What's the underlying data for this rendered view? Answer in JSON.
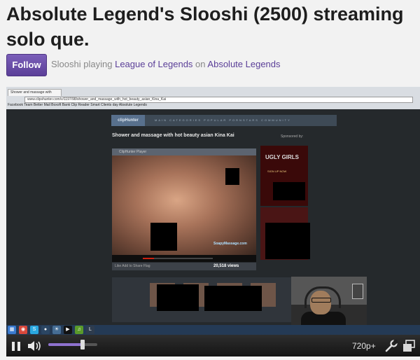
{
  "header": {
    "title": "Absolute Legend's Slooshi (2500) streaming solo que.",
    "follow_label": "Follow",
    "meta": {
      "user": "Slooshi",
      "playing": "playing",
      "game": "League of Legends",
      "on": "on",
      "team": "Absolute Legends"
    }
  },
  "stream": {
    "browser_tab": "Shower and massage with",
    "address": "www.clipshunter.com/v/1197/98/shower_and_massage_with_hot_beauty_asian_Kina_Kai",
    "bookmarks": "Facebook   Team Better   Mail   Boxoft   Bank   Clip Reader   Smart   Clients day   Absolute Legends",
    "site_logo": "clipHunter",
    "nav_items": "MAIN   CATEGORIES   POPULAR   PORNSTARS   COMMUNITY",
    "video_title": "Shower and massage with hot beauty asian Kina Kai",
    "sponsored_label": "Sponsored by:",
    "player_header": "ClipHunter Player",
    "watermark": "SoapyMassage.com",
    "views": "20,518 views",
    "toolbar_text": "Like   Add to   Share   Flag",
    "ad_text": "UGLY GIRLS",
    "ad_sub": "SIGN UP NOW",
    "taskbar_icons": [
      "win",
      "chrome",
      "skype",
      "steam",
      "media",
      "player",
      "spotify",
      "league"
    ]
  },
  "controls": {
    "volume_level": 0.7,
    "quality": "720p+"
  },
  "colors": {
    "brand_purple": "#6441a5",
    "link_purple": "#5b3f98",
    "slider_fill": "#8e72cf"
  }
}
